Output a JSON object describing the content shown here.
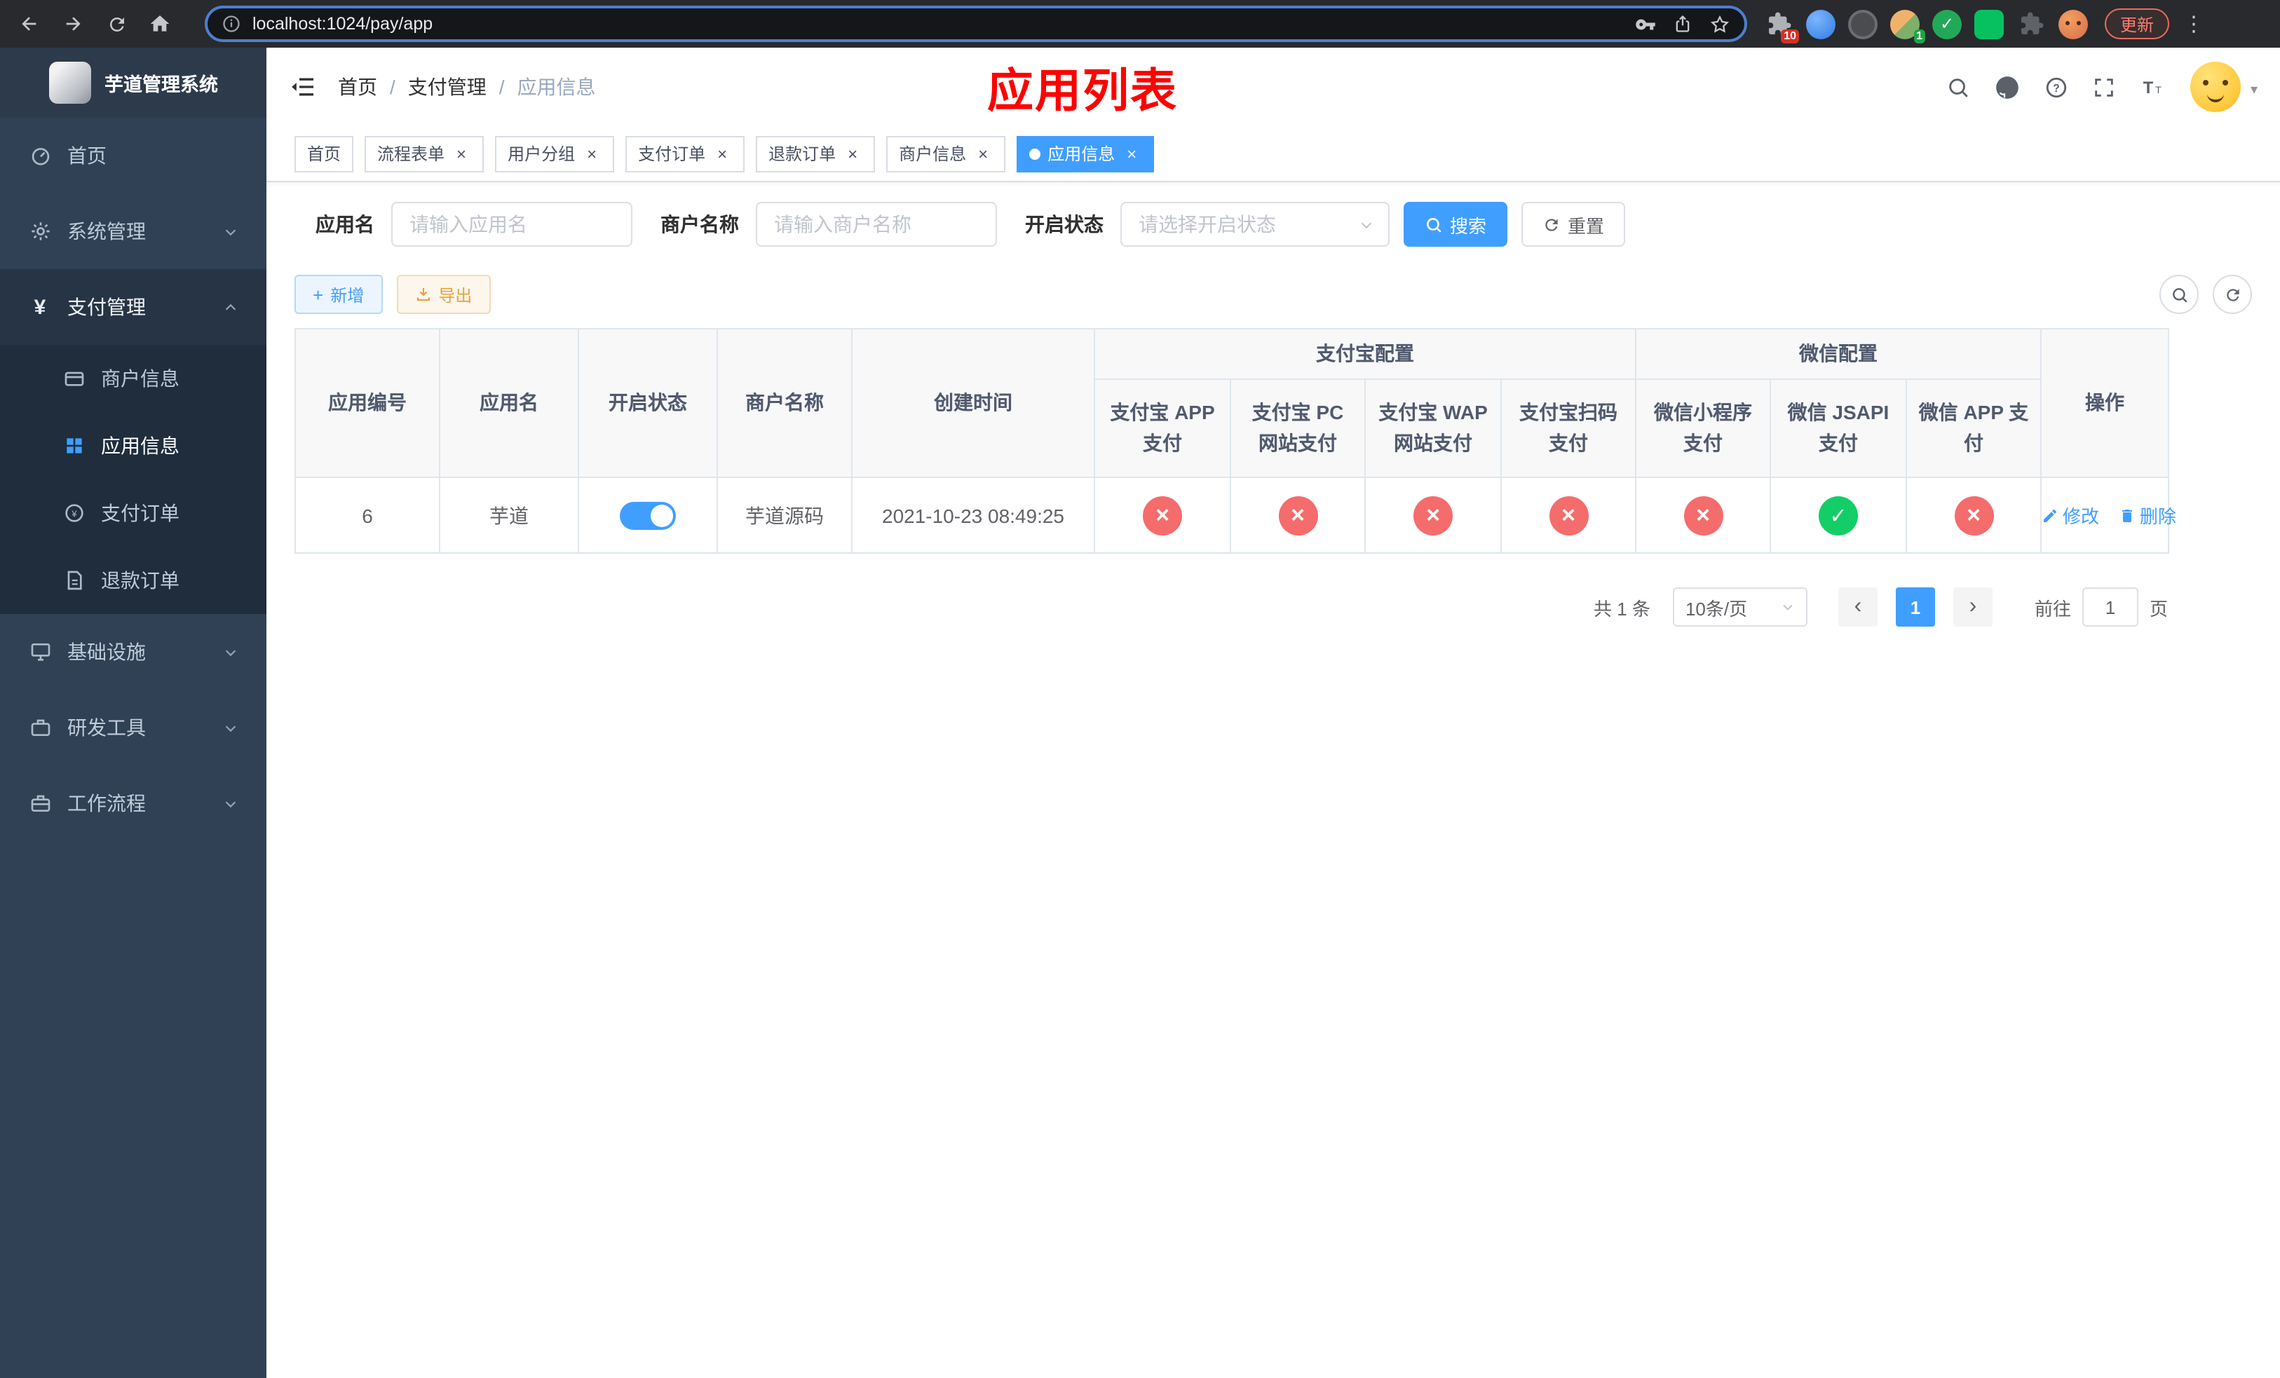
{
  "browser": {
    "url": "localhost:1024/pay/app",
    "update_button": "更新",
    "extension_badge": "10",
    "profile_badge": "1"
  },
  "sidebar": {
    "logo_title": "芋道管理系统",
    "items": [
      {
        "label": "首页"
      },
      {
        "label": "系统管理"
      },
      {
        "label": "支付管理",
        "children": [
          {
            "label": "商户信息"
          },
          {
            "label": "应用信息"
          },
          {
            "label": "支付订单"
          },
          {
            "label": "退款订单"
          }
        ]
      },
      {
        "label": "基础设施"
      },
      {
        "label": "研发工具"
      },
      {
        "label": "工作流程"
      }
    ]
  },
  "header": {
    "breadcrumb": [
      "首页",
      "支付管理",
      "应用信息"
    ],
    "page_title": "应用列表"
  },
  "tabs": [
    {
      "label": "首页"
    },
    {
      "label": "流程表单"
    },
    {
      "label": "用户分组"
    },
    {
      "label": "支付订单"
    },
    {
      "label": "退款订单"
    },
    {
      "label": "商户信息"
    },
    {
      "label": "应用信息"
    }
  ],
  "filters": {
    "app_name_label": "应用名",
    "app_name_placeholder": "请输入应用名",
    "merchant_label": "商户名称",
    "merchant_placeholder": "请输入商户名称",
    "status_label": "开启状态",
    "status_placeholder": "请选择开启状态",
    "search_button": "搜索",
    "reset_button": "重置"
  },
  "toolbar": {
    "add_button": "新增",
    "export_button": "导出"
  },
  "table": {
    "columns": {
      "id": "应用编号",
      "name": "应用名",
      "status": "开启状态",
      "merchant": "商户名称",
      "created": "创建时间",
      "action": "操作"
    },
    "groups": [
      {
        "label": "支付宝配置",
        "children": [
          "支付宝 APP 支付",
          "支付宝 PC 网站支付",
          "支付宝 WAP 网站支付",
          "支付宝扫码支付"
        ]
      },
      {
        "label": "微信配置",
        "children": [
          "微信小程序支付",
          "微信 JSAPI 支付",
          "微信 APP 支付"
        ]
      }
    ],
    "rows": [
      {
        "id": "6",
        "name": "芋道",
        "enabled": true,
        "merchant": "芋道源码",
        "created": "2021-10-23 08:49:25",
        "pay_configs": [
          "no",
          "no",
          "no",
          "no",
          "no",
          "yes",
          "no"
        ],
        "edit": "修改",
        "delete": "删除"
      }
    ]
  },
  "pagination": {
    "total": "共 1 条",
    "page_size": "10条/页",
    "page": "1",
    "goto_label": "前往",
    "goto_value": "1",
    "page_unit": "页"
  },
  "colors": {
    "primary": "#409eff",
    "success": "#13ce66",
    "danger": "#f56c6c",
    "warning": "#e6a23c",
    "title_red": "#ff0000",
    "sidebar_bg": "#304156"
  }
}
